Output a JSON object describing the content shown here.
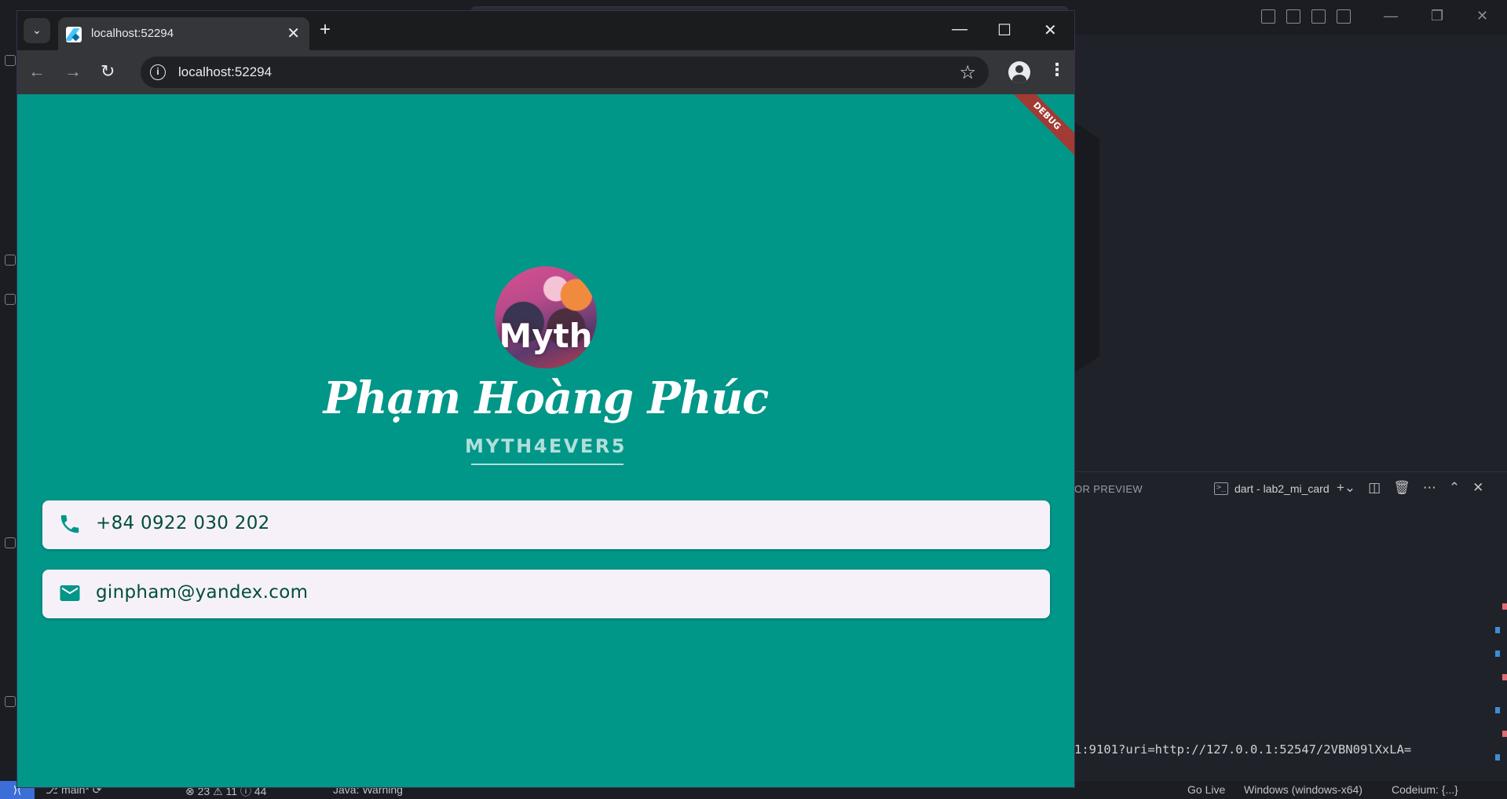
{
  "browser": {
    "tab_title": "localhost:52294",
    "url": "localhost:52294"
  },
  "app": {
    "avatar_text": "Myth",
    "name": "Phạm Hoàng Phúc",
    "handle": "MYTH4EVER5",
    "debug_banner": "DEBUG",
    "phone": "+84 0922 030 202",
    "email": "ginpham@yandex.com",
    "background_color": "#009688",
    "card_color": "#f6f1f8",
    "text_color": "#004d40"
  },
  "ide": {
    "panel_tab": "OR PREVIEW",
    "terminal_name": "dart - lab2_mi_card",
    "terminal_output": "1:9101?uri=http://127.0.0.1:52547/2VBN09lXxLA=",
    "status": {
      "branch": "main*",
      "errors": "23",
      "warnings": "11",
      "info": "44",
      "java": "Java: Warning",
      "go_live": "Go Live",
      "platform": "Windows (windows-x64)",
      "codeium": "Codeium: {...}"
    }
  }
}
